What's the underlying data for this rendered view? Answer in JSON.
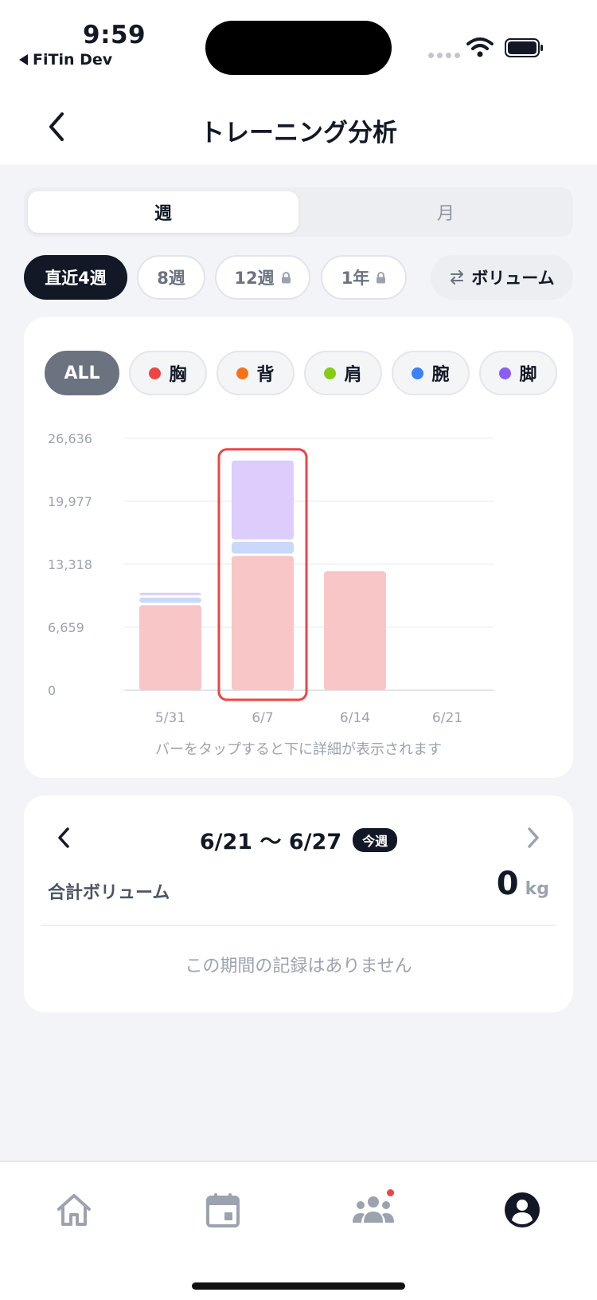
{
  "status_bar": {
    "time": "9:59",
    "back_app": "FiTin Dev"
  },
  "header": {
    "title": "トレーニング分析"
  },
  "segment": {
    "week": "週",
    "month": "月",
    "selected": "week"
  },
  "periods": [
    {
      "label": "直近4週",
      "active": true,
      "locked": false
    },
    {
      "label": "8週",
      "active": false,
      "locked": false
    },
    {
      "label": "12週",
      "active": false,
      "locked": true
    },
    {
      "label": "1年",
      "active": false,
      "locked": true
    }
  ],
  "metric_toggle": {
    "label": "ボリューム"
  },
  "muscle_filters": [
    {
      "label": "ALL",
      "color": null
    },
    {
      "label": "胸",
      "color": "#ef4444"
    },
    {
      "label": "背",
      "color": "#f97316"
    },
    {
      "label": "肩",
      "color": "#84cc16"
    },
    {
      "label": "腕",
      "color": "#3b82f6"
    },
    {
      "label": "脚",
      "color": "#8b5cf6"
    }
  ],
  "chart_data": {
    "type": "bar",
    "stacked": true,
    "categories": [
      "5/31",
      "6/7",
      "6/14",
      "6/21"
    ],
    "yticks": [
      "0",
      "6,659",
      "13,318",
      "19,977",
      "26,636"
    ],
    "ylim": [
      0,
      26636
    ],
    "grid": true,
    "selected_category": "6/7",
    "series": [
      {
        "name": "胸",
        "color": "#f8c6c6",
        "values": [
          9000,
          14200,
          12600,
          0
        ]
      },
      {
        "name": "腕",
        "color": "#c9d8fb",
        "values": [
          800,
          1500,
          0,
          0
        ]
      },
      {
        "name": "脚",
        "color": "#dccdfc",
        "values": [
          500,
          8600,
          0,
          0
        ]
      }
    ]
  },
  "chart_hint": "バーをタップすると下に詳細が表示されます",
  "detail": {
    "range": "6/21 〜 6/27",
    "badge": "今週",
    "total_label": "合計ボリューム",
    "total_value": "0",
    "total_unit": "kg",
    "empty_message": "この期間の記録はありません"
  },
  "tabs": [
    {
      "name": "home-icon",
      "active": false
    },
    {
      "name": "calendar-icon",
      "active": false
    },
    {
      "name": "community-icon",
      "active": false,
      "notification": true
    },
    {
      "name": "profile-icon",
      "active": true
    }
  ],
  "colors": {
    "primary": "#121826",
    "highlight": "#ef4444",
    "muted": "#9ca3af"
  }
}
